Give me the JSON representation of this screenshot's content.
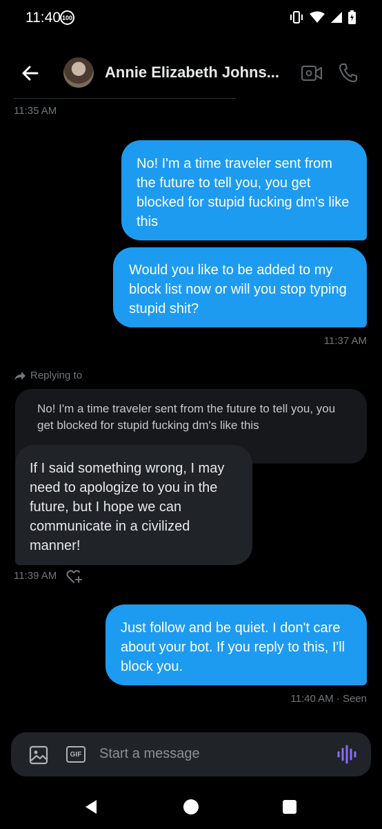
{
  "status_bar": {
    "time": "11:40",
    "badge": "100"
  },
  "header": {
    "contact_name": "Annie Elizabeth Johns..."
  },
  "messages": [
    {
      "timestamp": "11:35 AM"
    },
    {
      "direction": "sent",
      "text": "No! I'm a time traveler sent from the future to tell you, you get blocked for stupid fucking dm's like this"
    },
    {
      "direction": "sent",
      "text": "Would you like to be added to my block list now or will you stop typing stupid shit?",
      "timestamp": "11:37 AM"
    },
    {
      "direction": "received",
      "reply_label": "Replying to",
      "quoted_text": "No! I'm a time traveler sent from the future to tell you, you get blocked for stupid fucking dm's like this",
      "text": "If I said something wrong, I may need to apologize to you in the future, but I hope we can communicate in a civilized manner!",
      "timestamp": "11:39 AM"
    },
    {
      "direction": "sent",
      "text": "Just follow and be quiet. I don't care about your bot. If you reply to this, I'll block you.",
      "timestamp": "11:40 AM · Seen"
    }
  ],
  "composer": {
    "placeholder": "Start a message",
    "gif_label": "GIF"
  },
  "colors": {
    "background": "#000000",
    "sent_bubble": "#1d9bf0",
    "received_bubble": "#202327",
    "voice_icon": "#8a6cff"
  }
}
